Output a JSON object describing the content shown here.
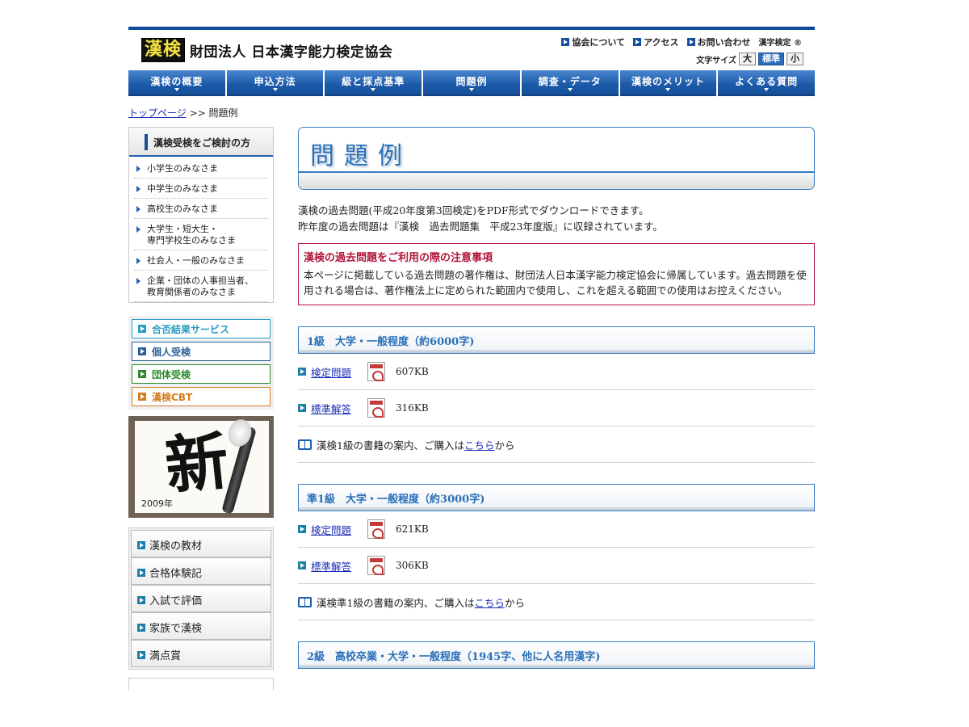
{
  "header": {
    "logo_mark": "漢検",
    "org_name": "財団法人 日本漢字能力検定協会",
    "links": [
      "協会について",
      "アクセス",
      "お問い合わせ"
    ],
    "kanken_reg": "漢字検定 ®",
    "font_size_label": "文字サイズ",
    "font_sizes": [
      "大",
      "標準",
      "小"
    ],
    "colors": {
      "brand": "#0d4a9b",
      "nav": "#1b59a8",
      "accent": "#2a6fb8",
      "note": "#b0153b"
    }
  },
  "nav": [
    "漢検の概要",
    "申込方法",
    "級と採点基準",
    "問題例",
    "調査・データ",
    "漢検のメリット",
    "よくある質問"
  ],
  "breadcrumb": {
    "home": "トップページ",
    "sep": ">>",
    "current": "問題例"
  },
  "sidebar": {
    "title": "漢検受検をご検討の方",
    "items": [
      "小学生のみなさま",
      "中学生のみなさま",
      "高校生のみなさま",
      "大学生・短大生・\n専門学校生のみなさま",
      "社会人・一般のみなさま",
      "企業・団体の人事担当者、\n教育関係者のみなさま"
    ],
    "services": [
      {
        "label": "合否結果サービス",
        "color": "#2a9cc4"
      },
      {
        "label": "個人受検",
        "color": "#2b5f9a"
      },
      {
        "label": "団体受検",
        "color": "#2c8a2c"
      },
      {
        "label": "漢検CBT",
        "color": "#d27d1c"
      }
    ],
    "photo": {
      "kanji": "新",
      "year": "2009年"
    },
    "links": [
      "漢検の教材",
      "合格体験記",
      "入試で評価",
      "家族で漢検",
      "満点賞"
    ]
  },
  "main": {
    "title": "問題例",
    "intro": [
      "漢検の過去問題(平成20年度第3回検定)をPDF形式でダウンロードできます。",
      "昨年度の過去問題は『漢検　過去問題集　平成23年度版』に収録されています。"
    ],
    "note": {
      "title": "漢検の過去問題をご利用の際の注意事項",
      "body": "本ページに掲載している過去問題の著作権は、財団法人日本漢字能力検定協会に帰属しています。過去問題を使用される場合は、著作権法上に定められた範囲内で使用し、これを超える範囲での使用はお控えください。"
    },
    "levels": [
      {
        "heading": "1級　大学・一般程度（約6000字)",
        "files": [
          {
            "label": "検定問題",
            "size": "607KB"
          },
          {
            "label": "標準解答",
            "size": "316KB"
          }
        ],
        "book_pre": "漢検1級の書籍の案内、ご購入は",
        "book_link": "こちら",
        "book_post": "から"
      },
      {
        "heading": "準1級　大学・一般程度（約3000字)",
        "files": [
          {
            "label": "検定問題",
            "size": "621KB"
          },
          {
            "label": "標準解答",
            "size": "306KB"
          }
        ],
        "book_pre": "漢検準1級の書籍の案内、ご購入は",
        "book_link": "こちら",
        "book_post": "から"
      },
      {
        "heading": "2級　高校卒業・大学・一般程度（1945字、他に人名用漢字)"
      }
    ]
  }
}
